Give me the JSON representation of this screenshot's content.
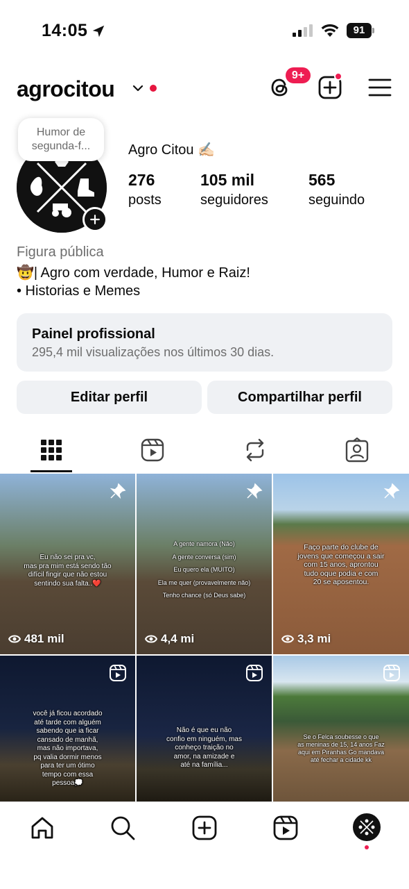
{
  "status_bar": {
    "time": "14:05",
    "battery": "91"
  },
  "header": {
    "username": "agrocitou",
    "threads_badge": "9+"
  },
  "profile": {
    "note_line1": "Humor de",
    "note_line2": "segunda-f...",
    "display_name": "Agro Citou ✍🏻",
    "stats": [
      {
        "value": "276",
        "label": "posts"
      },
      {
        "value": "105 mil",
        "label": "seguidores"
      },
      {
        "value": "565",
        "label": "seguindo"
      }
    ],
    "category": "Figura pública",
    "bio_line1": "🤠| Agro com verdade, Humor e Raiz!",
    "bio_line2": "• Historias e Memes"
  },
  "dashboard": {
    "title": "Painel profissional",
    "subtitle": "295,4 mil visualizações nos últimos 30 dias."
  },
  "buttons": {
    "edit": "Editar perfil",
    "share": "Compartilhar perfil"
  },
  "posts": [
    {
      "type": "pinned",
      "views": "481 mil",
      "caption": [
        "Eu não sei pra vc,",
        "mas pra mim está sendo tão",
        "difícil fingir que não estou",
        "sentindo sua falta..❤️"
      ]
    },
    {
      "type": "pinned",
      "views": "4,4 mi",
      "caption": [
        "A gente namora (Não)",
        "A gente conversa (sim)",
        "Eu quero ela (MUITO)",
        "Ela me quer (provavelmente não)",
        "Tenho chance (só Deus sabe)"
      ]
    },
    {
      "type": "pinned",
      "views": "3,3 mi",
      "caption": [
        "Faço parte do clube de",
        "jovens que começou a sair",
        "com 15 anos, aprontou",
        "tudo oque podia e com",
        "20 se aposentou."
      ]
    },
    {
      "type": "reel",
      "caption": [
        "você já ficou acordado",
        "até tarde com alguém",
        "sabendo que ia ficar",
        "cansado de manhã,",
        "mas não importava,",
        "pq valia dormir menos",
        "para ter um ótimo",
        "tempo com essa",
        "pessoa💭"
      ]
    },
    {
      "type": "reel",
      "caption": [
        "Não é que eu não",
        "confio em ninguém, mas",
        "conheço traição no",
        "amor, na amizade e",
        "até na família..."
      ]
    },
    {
      "type": "reel",
      "caption": [
        "Se o Felca soubesse o que",
        "as meninas de 15, 14 anos Faz",
        "aqui em Piranhas Go mandava",
        "até fechar a cidade kk"
      ]
    }
  ],
  "colors": {
    "accent_red": "#ee1d52",
    "button_gray": "#eff1f4",
    "muted_text": "#6e6e6e"
  }
}
